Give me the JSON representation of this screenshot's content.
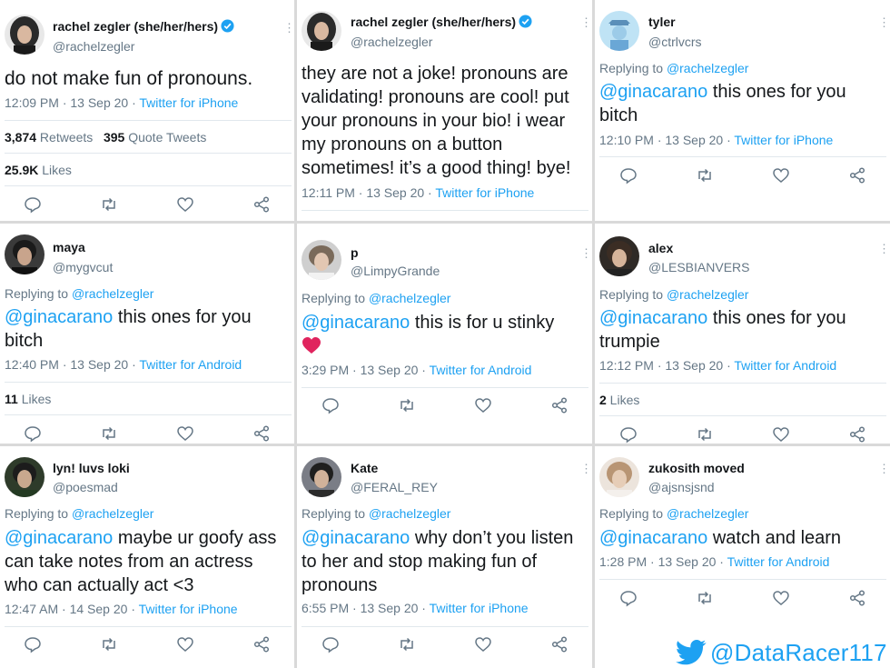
{
  "tweets": [
    {
      "name": "rachel zegler (she/her/hers)",
      "handle": "@rachelzegler",
      "verified": true,
      "body": "do not make fun of pronouns.",
      "time": "12:09 PM · 13 Sep 20 · ",
      "source": "Twitter for iPhone",
      "retweets": "3,874",
      "retweets_label": " Retweets",
      "quote_tweets": "395",
      "quote_label": " Quote Tweets",
      "likes": "25.9K",
      "likes_label": " Likes"
    },
    {
      "name": "rachel zegler (she/her/hers)",
      "handle": "@rachelzegler",
      "verified": true,
      "body": "they are not a joke! pronouns are validating! pronouns are cool! put your pronouns in your bio! i wear my pronouns on a button sometimes! it’s a good thing! bye!",
      "time": "12:11 PM · 13 Sep 20 · ",
      "source": "Twitter for iPhone"
    },
    {
      "name": "tyler",
      "handle": "@ctrlvcrs",
      "replying_label": "Replying to ",
      "replying_to": "@rachelzegler",
      "mention": "@ginacarano",
      "body": " this ones for you bitch",
      "time": "12:10 PM · 13 Sep 20 · ",
      "source": "Twitter for iPhone"
    },
    {
      "name": "maya",
      "handle": "@mygvcut",
      "replying_label": "Replying to ",
      "replying_to": "@rachelzegler",
      "mention": "@ginacarano",
      "body": " this ones for you bitch",
      "time": "12:40 PM · 13 Sep 20 · ",
      "source": "Twitter for Android",
      "likes": "11",
      "likes_label": " Likes"
    },
    {
      "name": "p",
      "handle": "@LimpyGrande",
      "replying_label": "Replying to ",
      "replying_to": "@rachelzegler",
      "mention": "@ginacarano",
      "body": "  this is for u stinky",
      "emoji": "heart-emoji",
      "time": "3:29 PM · 13 Sep 20 · ",
      "source": "Twitter for Android"
    },
    {
      "name": "alex",
      "handle": "@LESBIANVERS",
      "replying_label": "Replying to ",
      "replying_to": "@rachelzegler",
      "mention": "@ginacarano",
      "body": " this ones for you trumpie",
      "time": "12:12 PM · 13 Sep 20 · ",
      "source": "Twitter for Android",
      "likes": "2",
      "likes_label": " Likes"
    },
    {
      "name": "lyn! luvs loki",
      "handle": "@poesmad",
      "replying_label": "Replying to ",
      "replying_to": "@rachelzegler",
      "mention": "@ginacarano",
      "body": " maybe ur goofy ass can take notes from an actress who can actually act <3",
      "time": "12:47 AM · 14 Sep 20 · ",
      "source": "Twitter for iPhone"
    },
    {
      "name": "Kate",
      "handle": "@FERAL_REY",
      "replying_label": "Replying to ",
      "replying_to": "@rachelzegler",
      "mention": "@ginacarano",
      "body": " why don’t you listen to her and stop making fun of pronouns",
      "time": "6:55 PM · 13 Sep 20 · ",
      "source": "Twitter for iPhone"
    },
    {
      "name": "zukosith moved",
      "handle": "@ajsnsjsnd",
      "replying_label": "Replying to ",
      "replying_to": "@rachelzegler",
      "mention": "@ginacarano",
      "body": " watch and learn",
      "time": "1:28 PM · 13 Sep 20 · ",
      "source": "Twitter for Android"
    }
  ],
  "icons": [
    "reply-icon",
    "retweet-icon",
    "like-icon",
    "share-icon",
    "more-icon",
    "verified-badge-icon",
    "twitter-bird-icon"
  ],
  "colors": {
    "link": "#1da1f2",
    "muted": "#657786",
    "text": "#14171a",
    "like_red": "#e0245e"
  },
  "watermark": {
    "text": "@DataRacer117"
  }
}
